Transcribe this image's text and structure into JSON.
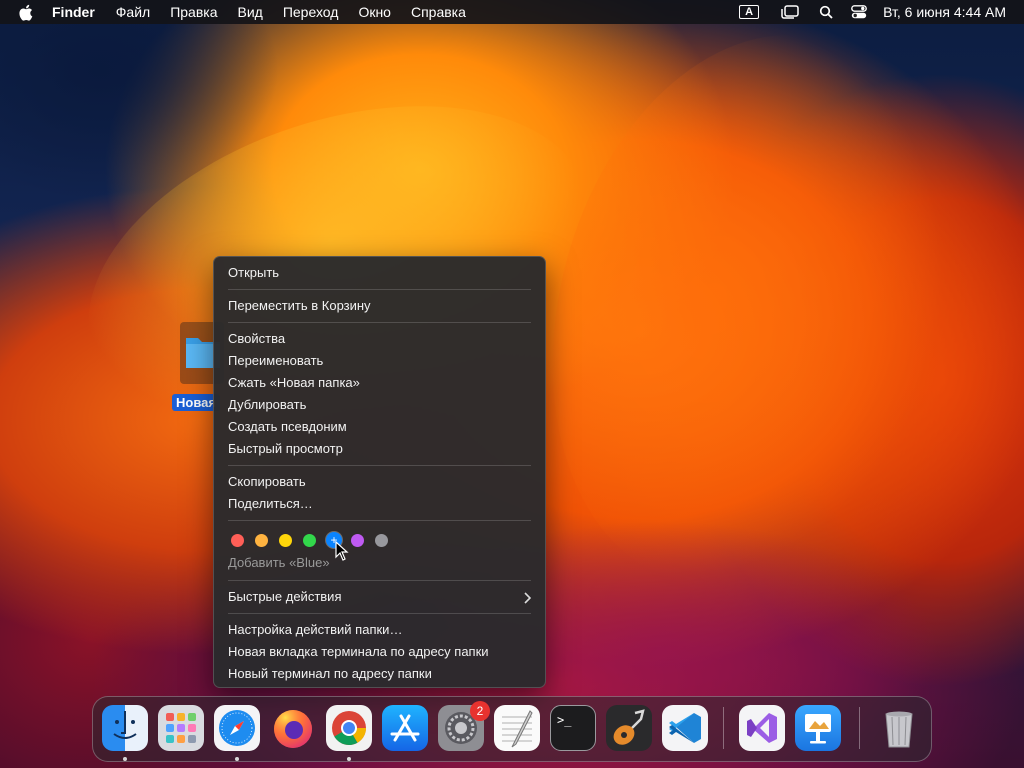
{
  "menubar": {
    "app_name": "Finder",
    "menus": [
      "Файл",
      "Правка",
      "Вид",
      "Переход",
      "Окно",
      "Справка"
    ],
    "input_indicator": "A",
    "clock": "Вт, 6 июня  4:44 AM"
  },
  "desktop": {
    "folder_label": "Новая"
  },
  "context_menu": {
    "open": "Открыть",
    "move_to_trash": "Переместить в Корзину",
    "get_info": "Свойства",
    "rename": "Переименовать",
    "compress": "Сжать «Новая папка»",
    "duplicate": "Дублировать",
    "make_alias": "Создать псевдоним",
    "quick_look": "Быстрый просмотр",
    "copy": "Скопировать",
    "share": "Поделиться…",
    "tag_colors": [
      "#ff5f57",
      "#ffb340",
      "#ffd60a",
      "#32d74b",
      "#0a84ff",
      "#bf5af2",
      "#98989d"
    ],
    "add_tag": "Добавить «Blue»",
    "quick_actions": "Быстрые действия",
    "folder_actions_setup": "Настройка действий папки…",
    "new_terminal_tab": "Новая вкладка терминала по адресу папки",
    "new_terminal": "Новый терминал по адресу папки"
  },
  "dock": {
    "apps": [
      "finder-icon",
      "launchpad-icon",
      "safari-icon",
      "firefox-icon",
      "chrome-icon",
      "app-store-icon",
      "system-settings-icon",
      "textedit-icon",
      "terminal-icon",
      "garageband-icon",
      "vscode-icon",
      "visual-studio-icon",
      "keynote-icon",
      "trash-icon"
    ],
    "settings_badge": "2",
    "terminal_prompt": ">_"
  }
}
